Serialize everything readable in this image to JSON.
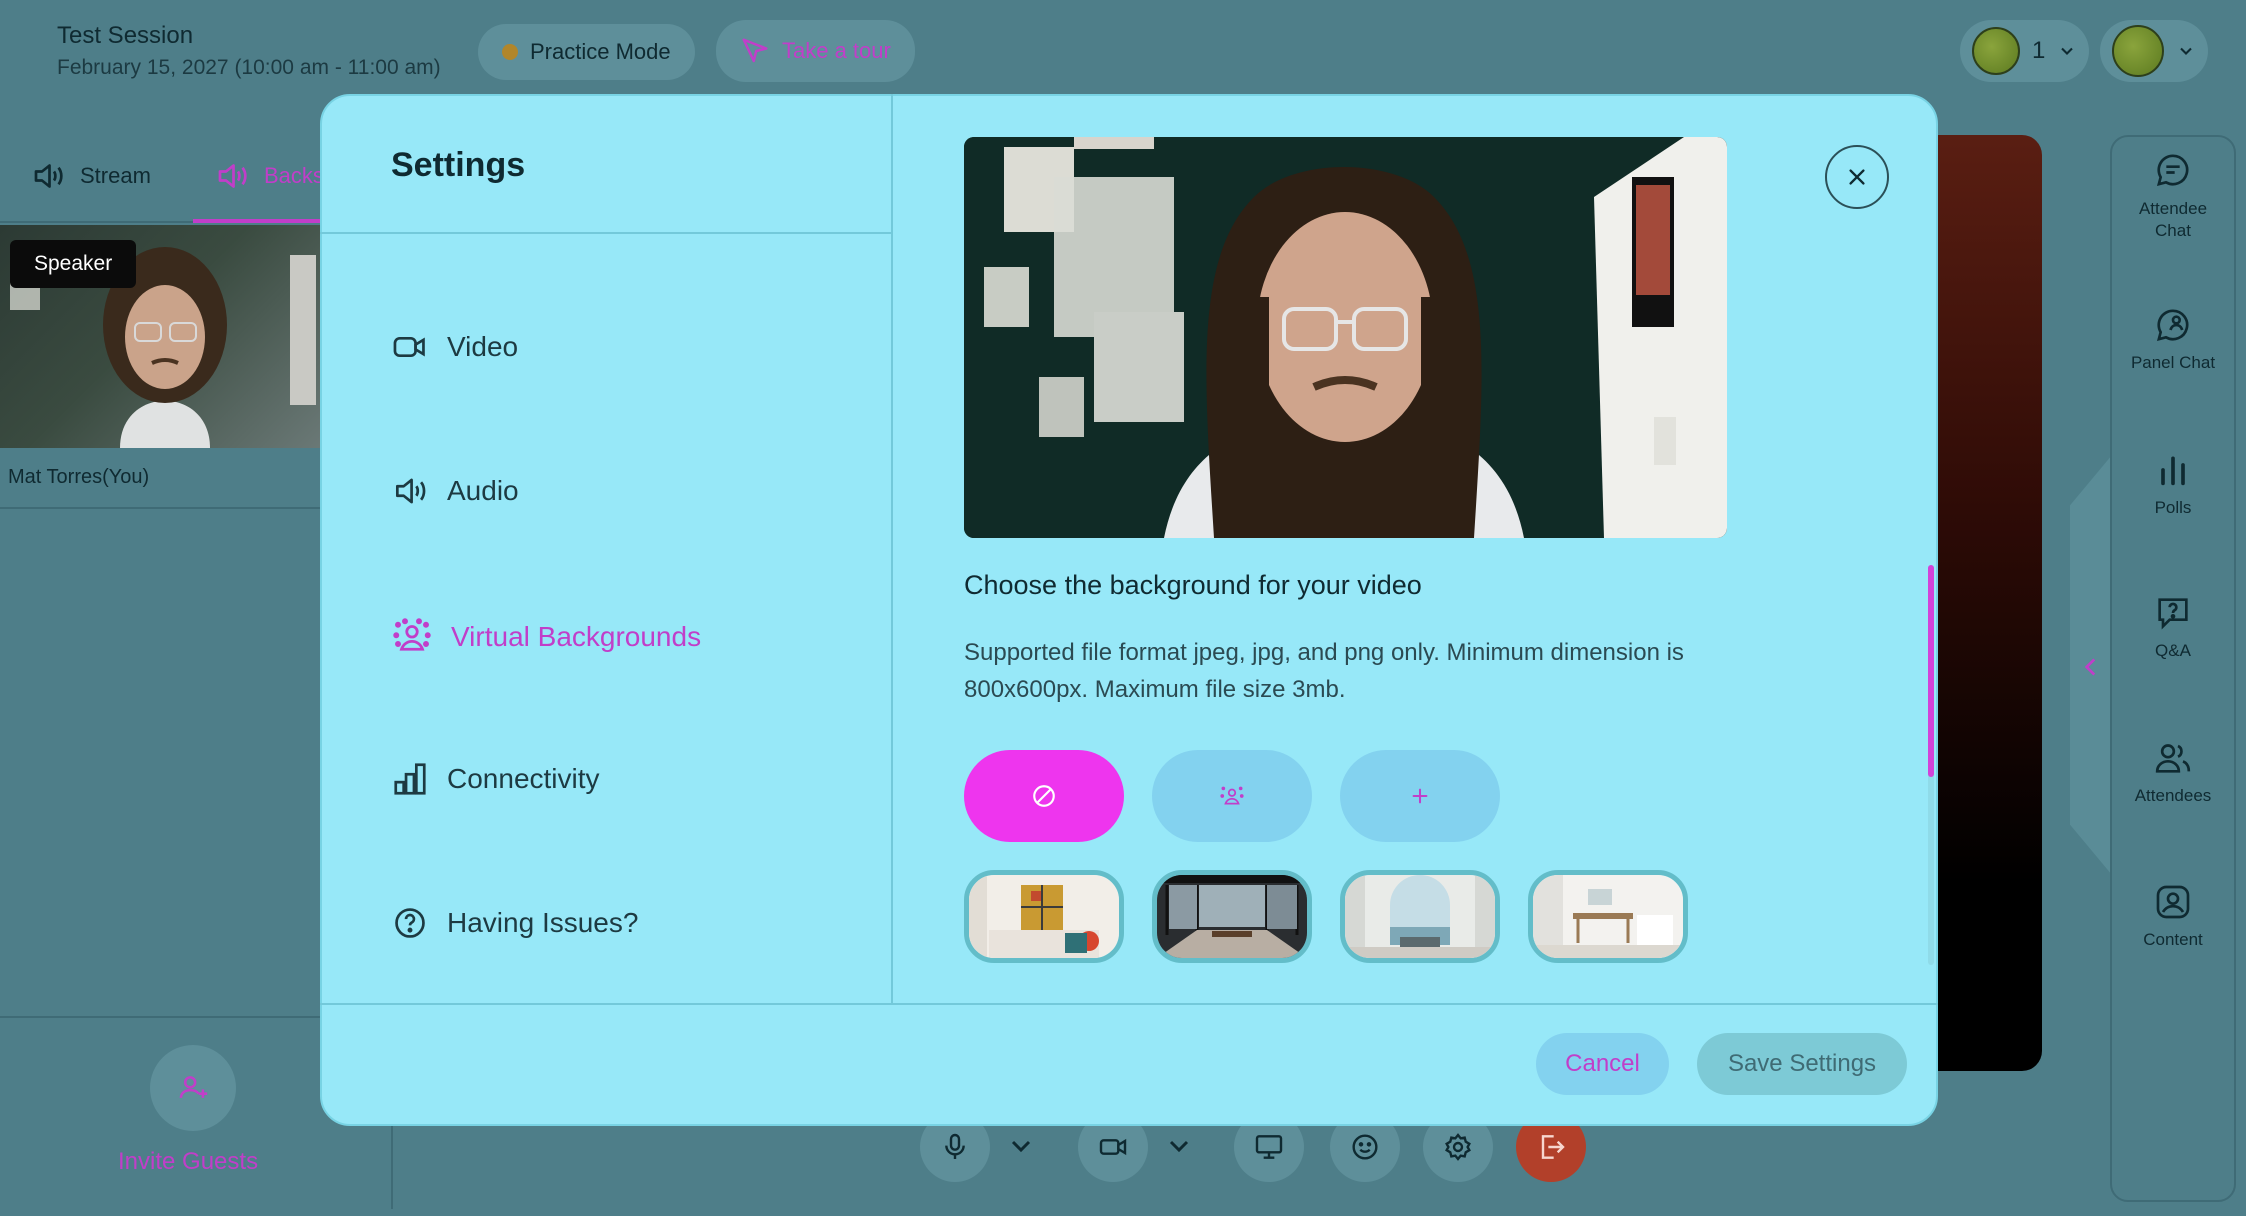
{
  "session": {
    "title": "Test Session",
    "date": "February 15, 2027 (10:00 am - 11:00 am)"
  },
  "topbar": {
    "practice_label": "Practice Mode",
    "tour_label": "Take a tour",
    "participants_count": "1"
  },
  "left_panel": {
    "tabs": [
      "Stream",
      "Backs"
    ],
    "speaker_badge": "Speaker",
    "self_name": "Mat Torres(You)",
    "invite_label": "Invite Guests"
  },
  "right_rail": {
    "items": [
      "Attendee Chat",
      "Panel Chat",
      "Polls",
      "Q&A",
      "Attendees",
      "Content"
    ]
  },
  "modal": {
    "title": "Settings",
    "nav": [
      {
        "label": "Video",
        "icon": "video-camera-icon"
      },
      {
        "label": "Audio",
        "icon": "speaker-icon"
      },
      {
        "label": "Virtual Backgrounds",
        "icon": "virtual-background-icon",
        "active": true
      },
      {
        "label": "Connectivity",
        "icon": "signal-bars-icon"
      },
      {
        "label": "Having Issues?",
        "icon": "help-circle-icon"
      }
    ],
    "choose_heading": "Choose the background for your video",
    "supported_text": "Supported file format jpeg, jpg, and png only. Minimum dimension is 800x600px. Maximum file size 3mb.",
    "options": [
      "none-icon",
      "blur-icon",
      "plus-icon"
    ],
    "cancel_label": "Cancel",
    "save_label": "Save Settings"
  },
  "colors": {
    "accent": "#c13ec9",
    "selected_option": "#ee35ee",
    "modal_bg": "#97e8f8",
    "page_bg": "#4e7e89"
  }
}
